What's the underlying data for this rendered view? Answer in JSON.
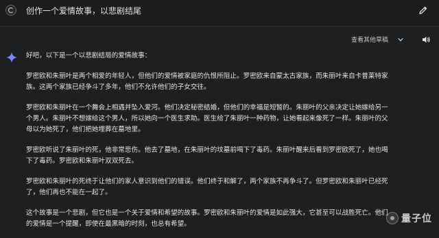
{
  "header": {
    "prompt": "创作一个爱情故事，以悲剧结尾"
  },
  "toolbar": {
    "drafts_label": "查看其他草稿"
  },
  "response": {
    "lines": [
      "好吧，以下是一个以悲剧结局的爱情故事：",
      "",
      "罗密欧和朱丽叶是两个相爱的年轻人，但他们的爱情被家庭的仇恨所阻止。罗密欧来自蒙太古家族，而朱丽叶来自卡普莱特家",
      "族。这两个家族已经争斗了多年，他们不允许他们的子女交往。",
      "",
      "罗密欧和朱丽叶在一个舞会上相遇并坠入爱河。他们决定秘密结婚，但他们的幸福是短暂的。朱丽叶的父亲决定让她嫁给另一",
      "个男人。朱丽叶不想嫁给这个男人，所以她向一个医生求助。医生给了朱丽叶一种药物，让她看起来像死了一样。朱丽叶的父",
      "母以为她死了，他们把她埋葬在墓地里。",
      "",
      "罗密欧听说了朱丽叶的死，他非常悲伤。他去了墓地，在朱丽叶的坟墓前喝下了毒药。朱丽叶醒来后看到罗密欧死了，她也喝",
      "下了毒药。罗密欧和朱丽叶双双死去。",
      "",
      "罗密欧和朱丽叶的死终于让他们的家人意识到他们的错误。他们终于和解了，两个家族不再争斗了。但罗密欧和朱丽叶已经死",
      "了，他们再也不能在一起了。",
      "",
      "这个故事是一个悲剧，但它也是一个关于爱情和希望的故事。罗密欧和朱丽叶的爱情是如此强大，它甚至可以战胜死亡。他们",
      "的爱情是一个提醒，即使在最黑暗的时刻，也总有希望。"
    ]
  },
  "watermark": {
    "text": "量子位"
  },
  "icons": {
    "avatar": "user-avatar-icon",
    "edit": "pencil-edit-icon",
    "chevron": "chevron-down-icon",
    "speaker": "speaker-volume-icon",
    "spark": "gemini-sparkle-icon"
  },
  "colors": {
    "background": "#1b1c1d",
    "panel": "#1e1f20",
    "text": "#e3e3e3",
    "spark_blue": "#4f8cf7",
    "spark_purple": "#a87ffb"
  }
}
